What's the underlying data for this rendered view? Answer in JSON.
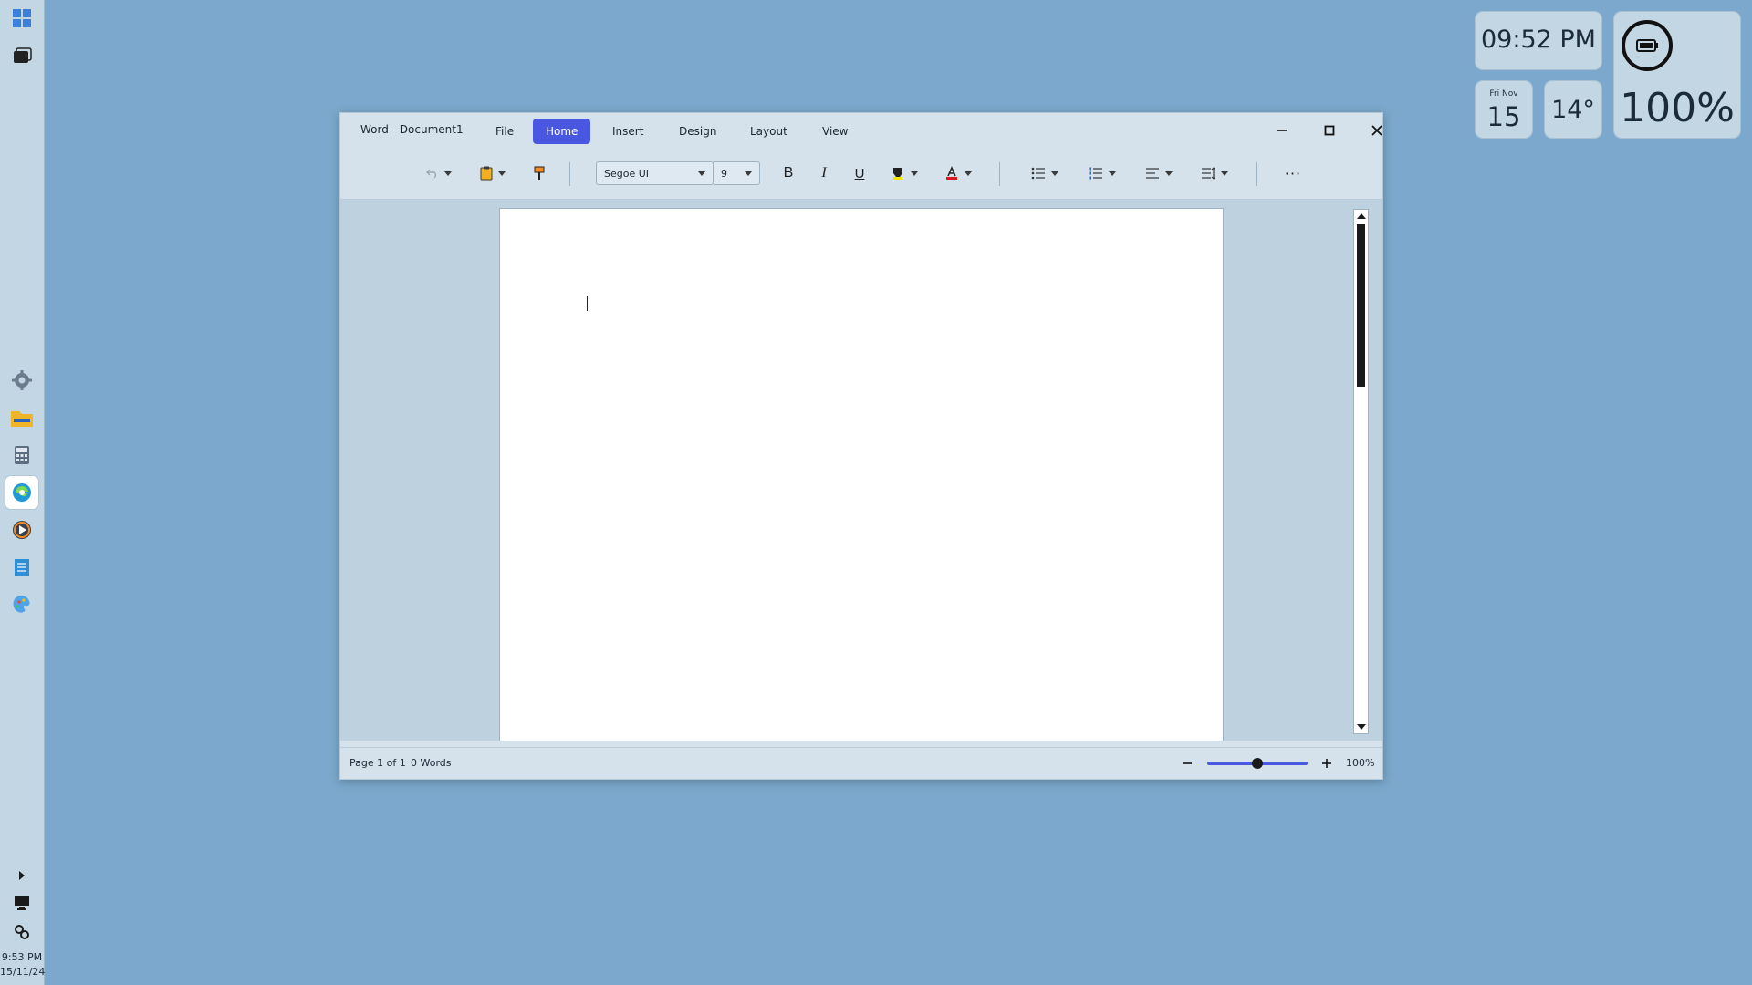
{
  "taskbar": {
    "icons": [
      "windows-start-icon",
      "task-view-icon",
      "settings-icon",
      "file-explorer-icon",
      "calculator-icon",
      "edge-browser-icon",
      "media-player-icon",
      "notepad-icon",
      "paint-icon"
    ],
    "time": "9:53 PM",
    "date": "15/11/24"
  },
  "widgets": {
    "clock": "09:52 PM",
    "date_weekday_month": "Fri Nov",
    "date_day": "15",
    "temperature": "14°",
    "battery_percent": "100%"
  },
  "window": {
    "title": "Word - Document1",
    "menu": [
      "File",
      "Home",
      "Insert",
      "Design",
      "Layout",
      "View"
    ],
    "active_menu": "Home"
  },
  "ribbon": {
    "font_name": "Segoe UI",
    "font_size": "9",
    "bold": "B",
    "italic": "I",
    "underline": "U",
    "more": "···",
    "highlight_color": "#f2e600",
    "font_color": "#e0141e"
  },
  "status": {
    "page": "Page 1 of 1",
    "words": "0 Words",
    "zoom": "100%",
    "zoom_fraction": 0.5
  },
  "colors": {
    "accent": "#4a57e0",
    "desktop": "#7ba8cc"
  }
}
